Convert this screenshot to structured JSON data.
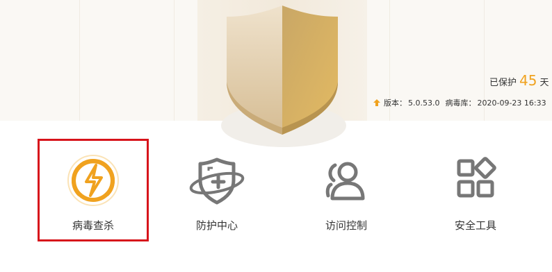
{
  "status": {
    "protected_prefix": "已保护",
    "protected_days": "45",
    "protected_suffix": "天",
    "version_label": "版本：",
    "version_value": "5.0.53.0",
    "virus_db_label": "病毒库：",
    "virus_db_value": "2020-09-23 16:33"
  },
  "colors": {
    "accent": "#f0a21f",
    "highlight_border": "#d7141b",
    "icon_gray": "#777777"
  },
  "tiles": [
    {
      "label": "病毒查杀",
      "icon": "lightning-circle-icon",
      "selected": true
    },
    {
      "label": "防护中心",
      "icon": "shield-plus-icon",
      "selected": false
    },
    {
      "label": "访问控制",
      "icon": "users-icon",
      "selected": false
    },
    {
      "label": "安全工具",
      "icon": "apps-grid-icon",
      "selected": false
    }
  ]
}
